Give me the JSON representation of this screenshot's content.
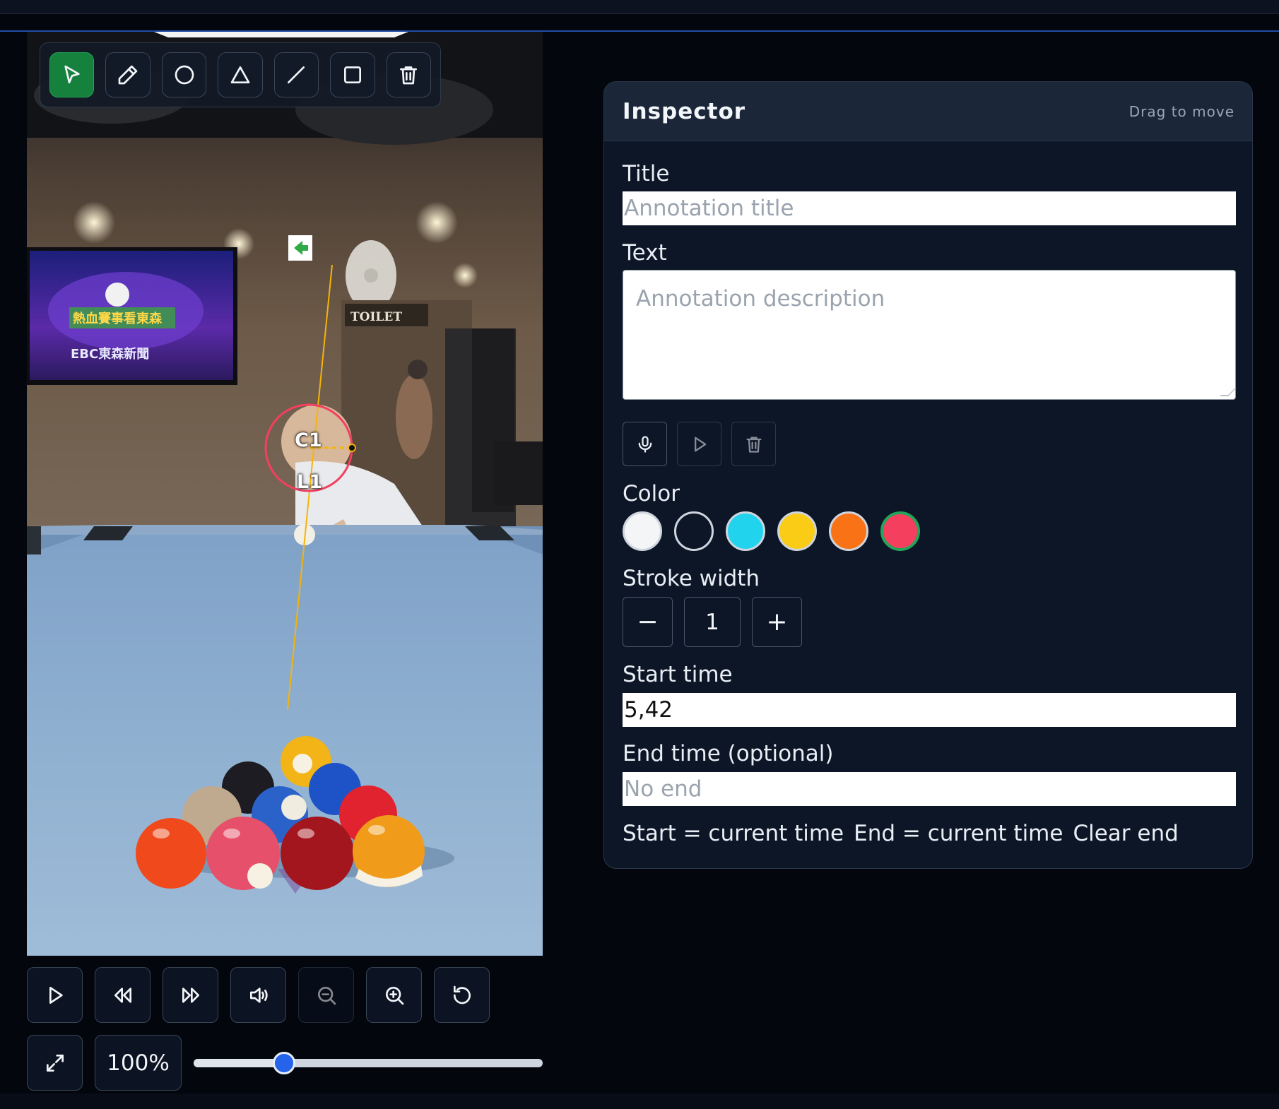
{
  "toolbar": {
    "tools": [
      "select-tool",
      "pencil-tool",
      "circle-tool",
      "triangle-tool",
      "line-tool",
      "rectangle-tool",
      "delete-tool"
    ],
    "active_tool": "select-tool"
  },
  "video": {
    "shape_labels": {
      "circle": "C1",
      "line": "L1"
    },
    "screen_text": {
      "tv_lower": "EBC東森新聞",
      "tv_upper": "熱血賽事看東森",
      "sign": "TOILET"
    }
  },
  "player": {
    "buttons": [
      "play",
      "rewind",
      "fast-forward",
      "volume",
      "zoom-out",
      "zoom-in",
      "reset"
    ],
    "zoom_label": "100%",
    "slider_fraction": 0.26
  },
  "inspector": {
    "title": "Inspector",
    "drag_hint": "Drag to move",
    "title_label": "Title",
    "title_placeholder": "Annotation title",
    "text_label": "Text",
    "text_placeholder": "Annotation description",
    "color_label": "Color",
    "colors": [
      "#f4f5f7",
      "#0d1626",
      "#22d3ee",
      "#facc15",
      "#f97316",
      "#f43f5e"
    ],
    "selected_color": "#f43f5e",
    "stroke_label": "Stroke width",
    "stroke_minus": "−",
    "stroke_value": "1",
    "stroke_plus": "+",
    "start_label": "Start time",
    "start_value": "5,42",
    "end_label": "End time (optional)",
    "end_placeholder": "No end",
    "links": {
      "start_now": "Start = current time",
      "end_now": "End = current time",
      "clear_end": "Clear end"
    }
  }
}
